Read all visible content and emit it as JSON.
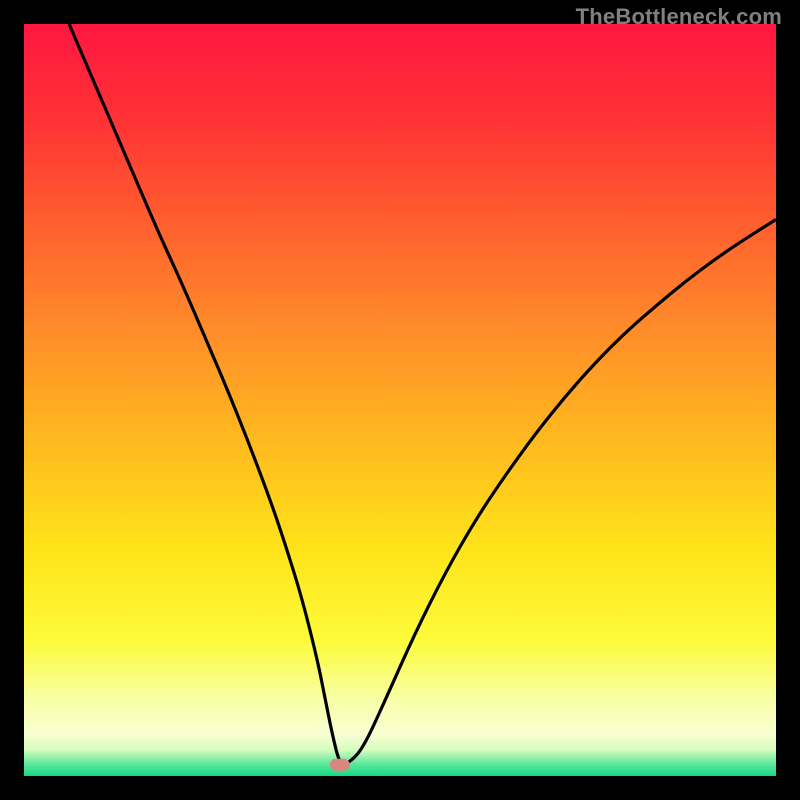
{
  "watermark": "TheBottleneck.com",
  "colors": {
    "frame_bg": "#000000",
    "curve": "#000000",
    "marker_fill": "#d9877d",
    "gradient_stops": [
      {
        "offset": 0.0,
        "color": "#ff1740"
      },
      {
        "offset": 0.12,
        "color": "#ff3036"
      },
      {
        "offset": 0.25,
        "color": "#ff5a2f"
      },
      {
        "offset": 0.4,
        "color": "#ff8a2a"
      },
      {
        "offset": 0.55,
        "color": "#ffb81f"
      },
      {
        "offset": 0.7,
        "color": "#ffe41a"
      },
      {
        "offset": 0.82,
        "color": "#fdfb3a"
      },
      {
        "offset": 0.9,
        "color": "#f8ffa8"
      },
      {
        "offset": 0.945,
        "color": "#f8ffd2"
      },
      {
        "offset": 0.965,
        "color": "#d6fcbe"
      },
      {
        "offset": 0.985,
        "color": "#57e79a"
      },
      {
        "offset": 1.0,
        "color": "#14d884"
      }
    ]
  },
  "chart_data": {
    "type": "line",
    "title": "",
    "xlabel": "",
    "ylabel": "",
    "xlim": [
      0,
      100
    ],
    "ylim": [
      0,
      100
    ],
    "grid": false,
    "marker": {
      "x": 42,
      "y": 1.5
    },
    "series": [
      {
        "name": "bottleneck-curve",
        "x": [
          6,
          9,
          12,
          15,
          18,
          21,
          24,
          27,
          30,
          33,
          35,
          37,
          39,
          40,
          41,
          42,
          43,
          45,
          48,
          52,
          56,
          60,
          64,
          68,
          72,
          76,
          80,
          84,
          88,
          92,
          96,
          100
        ],
        "y": [
          100,
          93,
          86,
          79,
          72,
          65.5,
          58.5,
          51.5,
          44,
          36,
          30,
          23.5,
          15.5,
          10.5,
          5.5,
          1.5,
          1.6,
          3.5,
          10,
          19,
          27,
          34,
          40,
          45.5,
          50.5,
          55,
          59,
          62.5,
          65.8,
          68.8,
          71.5,
          74
        ]
      }
    ]
  }
}
